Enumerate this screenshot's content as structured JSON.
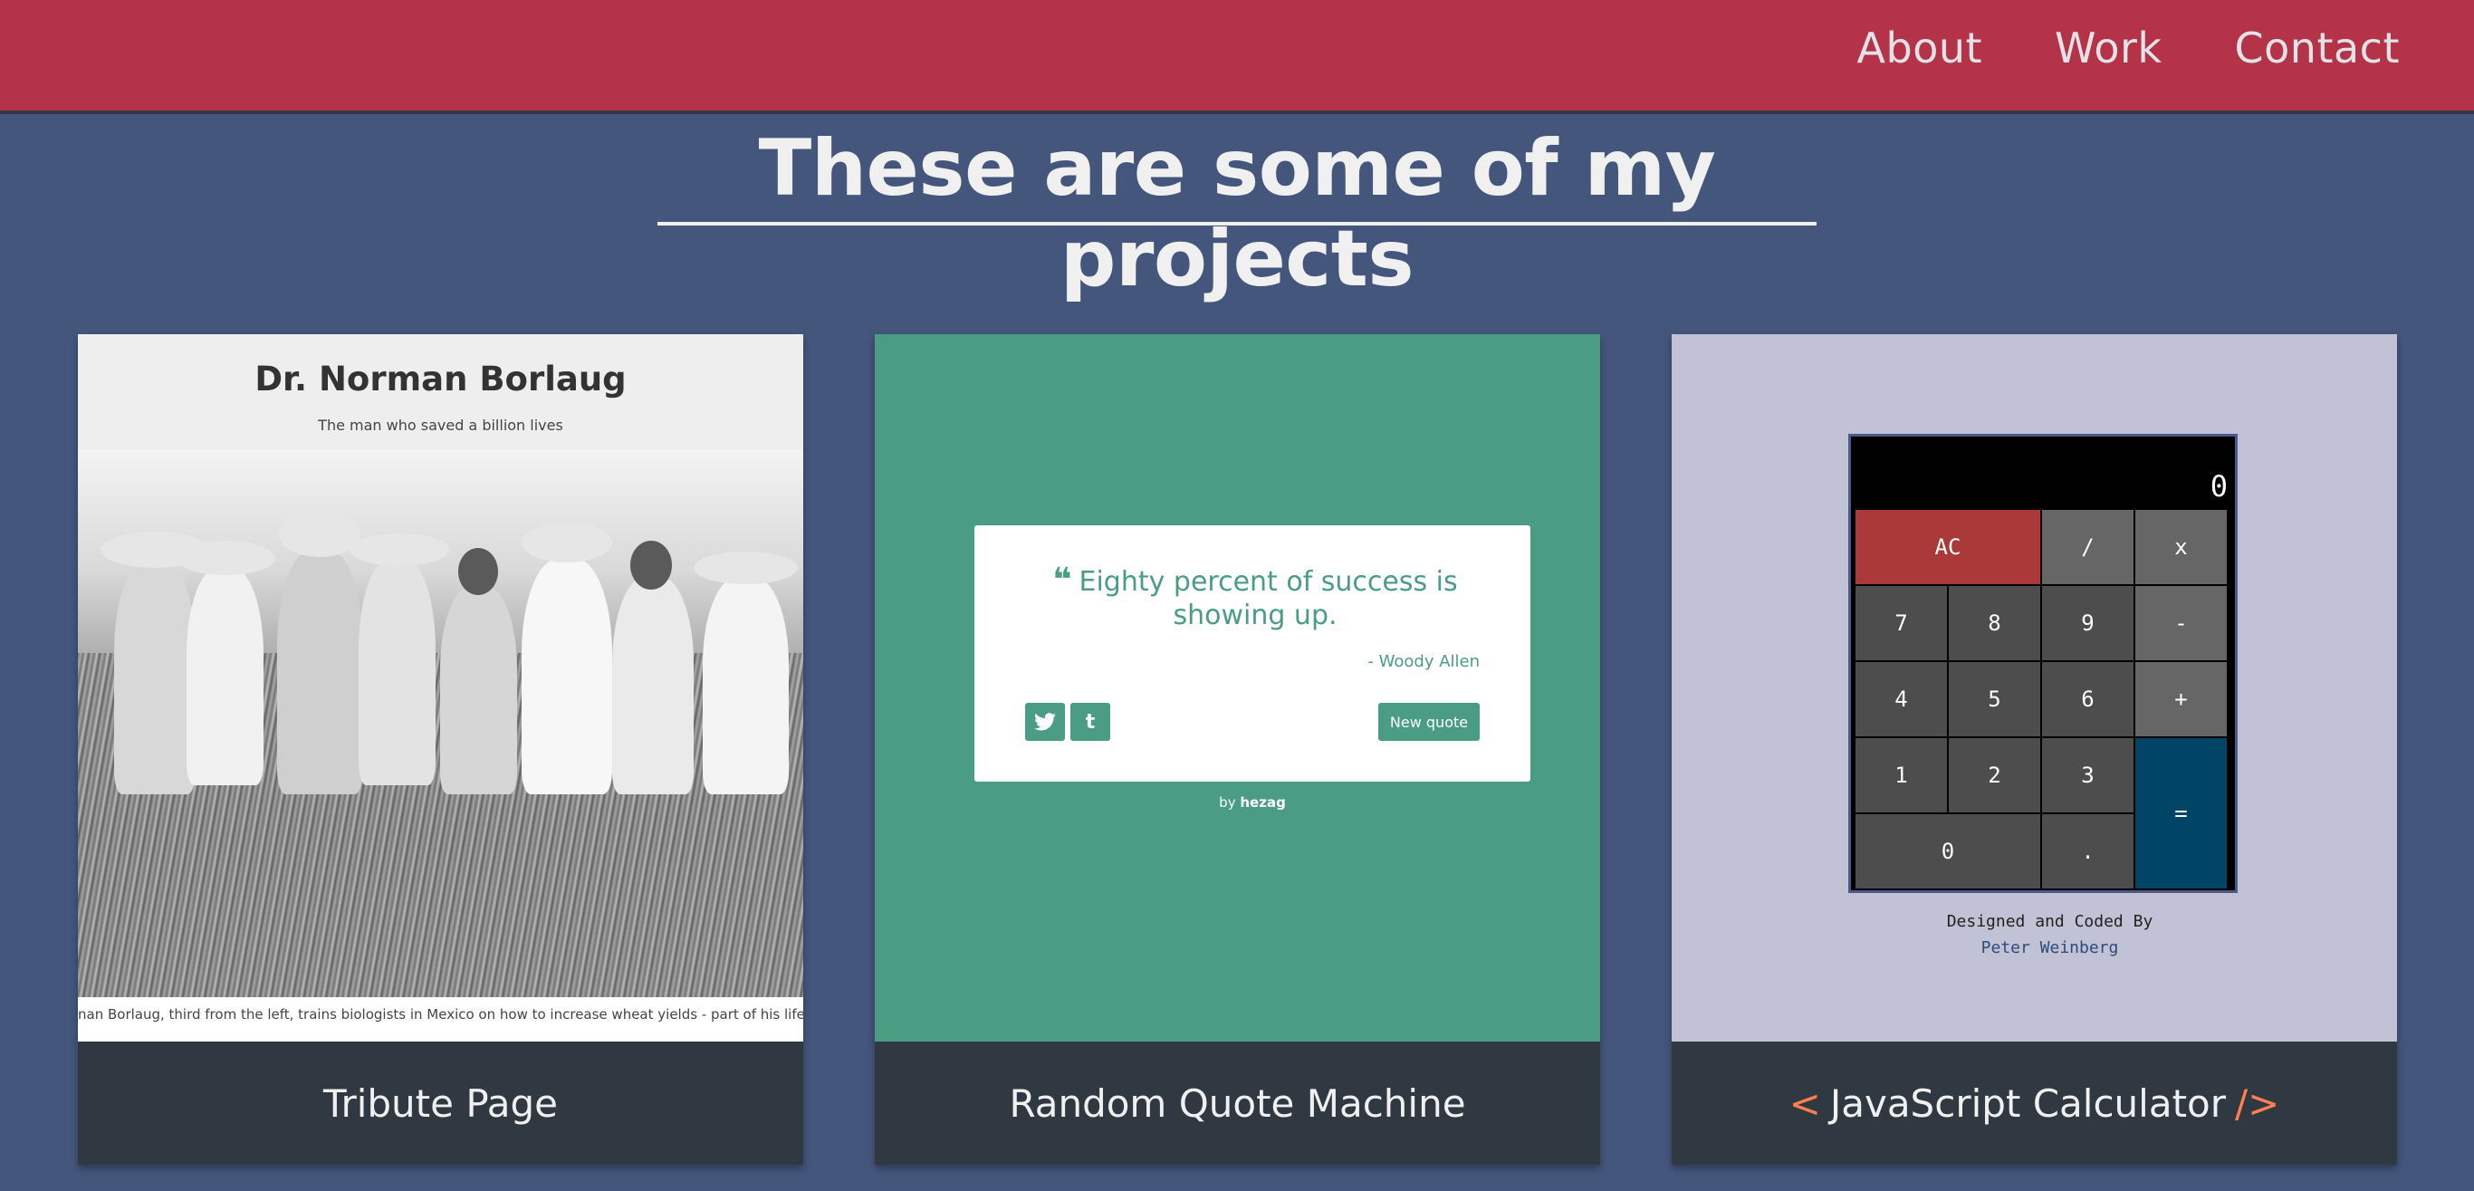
{
  "nav": {
    "links": [
      "About",
      "Work",
      "Contact"
    ]
  },
  "header": {
    "title": "These are some of my projects"
  },
  "projects": [
    {
      "caption": "Tribute Page",
      "preview": {
        "title": "Dr. Norman Borlaug",
        "subtitle": "The man who saved a billion lives",
        "image_caption": "nan Borlaug, third from the left, trains biologists in Mexico on how to increase wheat yields - part of his life-long war on"
      }
    },
    {
      "caption": "Random Quote Machine",
      "preview": {
        "quote_icon": "quote-icon",
        "quote": "Eighty percent of success is showing up.",
        "author": "- Woody Allen",
        "twitter_label": "twitter-icon",
        "tumblr_label": "t",
        "new_quote_label": "New quote",
        "by_prefix": "by",
        "by_author": "hezag"
      }
    },
    {
      "caption": "JavaScript Calculator",
      "caption_prefix": "<",
      "caption_suffix": "/>",
      "preview": {
        "display": "0",
        "keys": [
          "AC",
          "/",
          "x",
          "7",
          "8",
          "9",
          "-",
          "4",
          "5",
          "6",
          "+",
          "1",
          "2",
          "3",
          "=",
          "0",
          "."
        ],
        "credit_line1": "Designed and Coded By",
        "credit_line2": "Peter Weinberg"
      }
    }
  ],
  "colors": {
    "background": "#45567d",
    "nav": "#be3144",
    "caption_bg": "#303841",
    "quote_green": "#4a9d82",
    "calc_bg": "#c2c2d6",
    "accent_orange": "#ff7f50"
  }
}
